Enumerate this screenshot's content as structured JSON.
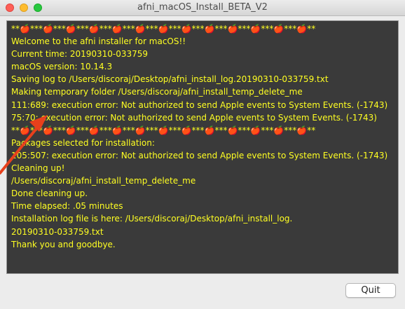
{
  "window": {
    "title": "afni_macOS_Install_BETA_V2"
  },
  "console": {
    "lines": [
      "**🍎***🍎***🍎***🍎***🍎***🍎***🍎***🍎***🍎***🍎***🍎***🍎***🍎**",
      "Welcome to the afni installer for macOS!!",
      "Current time: 20190310-033759",
      "macOS version: 10.14.3",
      "Saving log to /Users/discoraj/Desktop/afni_install_log.20190310-033759.txt",
      "Making temporary folder /Users/discoraj/afni_install_temp_delete_me",
      "111:689: execution error: Not authorized to send Apple events to System Events. (-1743)",
      "75:70: execution error: Not authorized to send Apple events to System Events. (-1743)",
      "**🍎***🍎***🍎***🍎***🍎***🍎***🍎***🍎***🍎***🍎***🍎***🍎***🍎**",
      "Packages selected for installation:",
      "105:507: execution error: Not authorized to send Apple events to System Events. (-1743)",
      "Cleaning up!",
      "/Users/discoraj/afni_install_temp_delete_me",
      "Done cleaning up.",
      "Time elapsed: .05 minutes",
      "Installation log file is here: /Users/discoraj/Desktop/afni_install_log.",
      "20190310-033759.txt",
      "Thank you and goodbye."
    ]
  },
  "buttons": {
    "quit_label": "Quit"
  },
  "colors": {
    "console_bg": "#3a3a3a",
    "console_text": "#ffff22",
    "annotation_arrow": "#e8401c"
  }
}
